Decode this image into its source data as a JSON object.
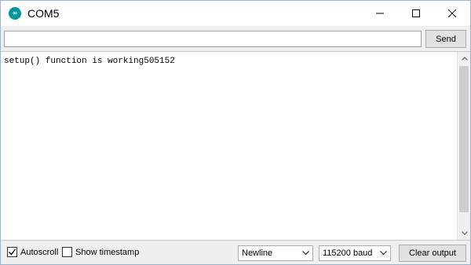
{
  "window": {
    "title": "COM5",
    "app_icon_text": "∞",
    "controls": [
      "minimize-icon",
      "maximize-icon",
      "close-icon"
    ]
  },
  "input_row": {
    "value": "",
    "placeholder": "",
    "send_label": "Send"
  },
  "output": {
    "text": "setup() function is working505152"
  },
  "bottom_bar": {
    "autoscroll": {
      "label": "Autoscroll",
      "checked": true
    },
    "timestamp": {
      "label": "Show timestamp",
      "checked": false
    },
    "line_ending": {
      "selected": "Newline"
    },
    "baud_rate": {
      "selected": "115200 baud"
    },
    "clear_label": "Clear output"
  },
  "colors": {
    "accent": "#00979c",
    "window_border": "#9ab6cf",
    "chrome_bg": "#f0f0f0",
    "button_bg": "#e1e1e1"
  }
}
